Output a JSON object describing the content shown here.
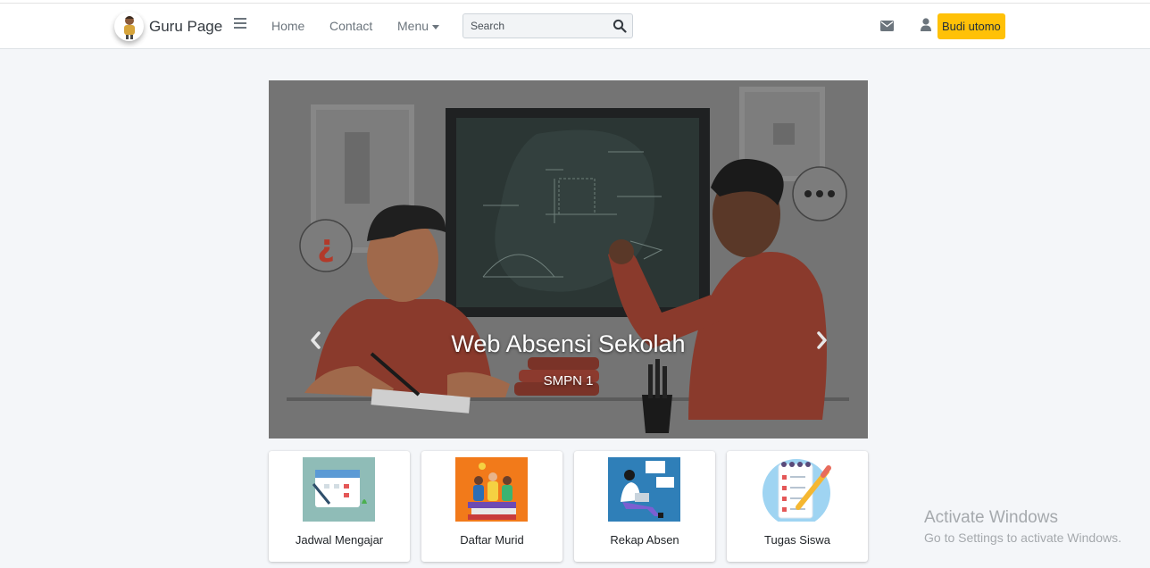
{
  "navbar": {
    "brand": "Guru Page",
    "links": {
      "home": "Home",
      "contact": "Contact",
      "menu": "Menu"
    },
    "search_placeholder": "Search",
    "user_name": "Budi utomo"
  },
  "carousel": {
    "title": "Web Absensi Sekolah",
    "subtitle": "SMPN 1"
  },
  "cards": [
    {
      "label": "Jadwal Mengajar"
    },
    {
      "label": "Daftar Murid"
    },
    {
      "label": "Rekap Absen"
    },
    {
      "label": "Tugas Siswa"
    }
  ],
  "watermark": {
    "title": "Activate Windows",
    "subtitle": "Go to Settings to activate Windows."
  },
  "colors": {
    "accent": "#ffc107",
    "card1_bg": "#8fbcb7",
    "card2_bg": "#f27a1a",
    "card3_bg": "#2f7fb8",
    "card4_bg": "#9fd4f2"
  }
}
